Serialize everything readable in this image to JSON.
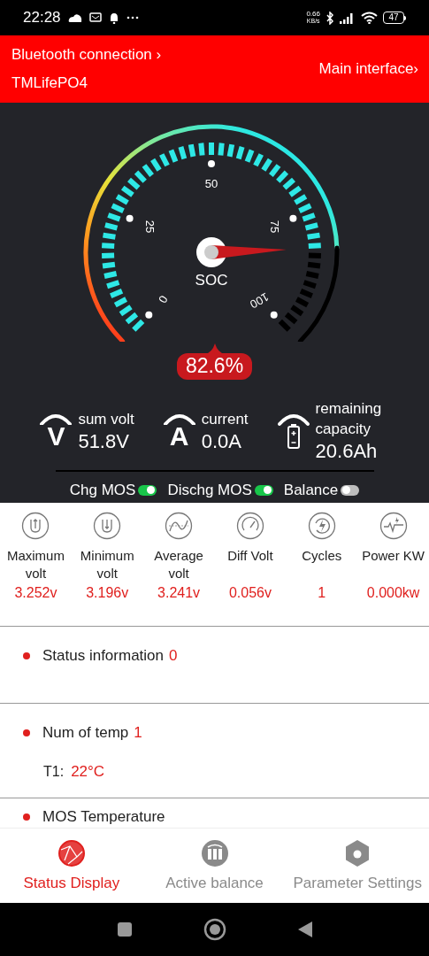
{
  "status_bar": {
    "time": "22:28",
    "speed": "0.66",
    "speed_unit": "KB/s",
    "battery": "47"
  },
  "header": {
    "connection": "Bluetooth connection ›",
    "device": "TMLifePO4",
    "main_link": "Main interface›"
  },
  "gauge": {
    "label": "SOC",
    "value": "82.6%",
    "scale_labels": [
      "0",
      "25",
      "50",
      "75",
      "100"
    ]
  },
  "readings": [
    {
      "glyph": "V",
      "kind": "letter",
      "label": "sum volt",
      "value": "51.8V"
    },
    {
      "glyph": "A",
      "kind": "letter",
      "label": "current",
      "value": "0.0A"
    },
    {
      "kind": "battery",
      "label": "remaining capacity",
      "value": "20.6Ah"
    }
  ],
  "switches": [
    {
      "label": "Chg MOS",
      "on": true
    },
    {
      "label": "Dischg MOS",
      "on": true
    },
    {
      "label": "Balance",
      "on": false
    }
  ],
  "metrics": [
    {
      "kind": "max",
      "label": "Maximum volt",
      "value": "3.252v"
    },
    {
      "kind": "min",
      "label": "Minimum volt",
      "value": "3.196v"
    },
    {
      "kind": "avg",
      "label": "Average volt",
      "value": "3.241v"
    },
    {
      "kind": "diff",
      "label": "Diff Volt",
      "value": "0.056v"
    },
    {
      "kind": "cycles",
      "label": "Cycles",
      "value": "1"
    },
    {
      "kind": "power",
      "label": "Power KW",
      "value": "0.000kw"
    }
  ],
  "sections": [
    {
      "title": "Status information",
      "count": "0"
    },
    {
      "title": "Num of temp",
      "count": "1",
      "items": [
        {
          "name": "T1:",
          "value": "22°C"
        }
      ]
    },
    {
      "title": "MOS Temperature"
    }
  ],
  "tabs": [
    {
      "label": "Status Display",
      "kind": "status",
      "selected": true
    },
    {
      "label": "Active balance",
      "kind": "balance",
      "selected": false
    },
    {
      "label": "Parameter Settings",
      "kind": "settings",
      "selected": false
    }
  ]
}
